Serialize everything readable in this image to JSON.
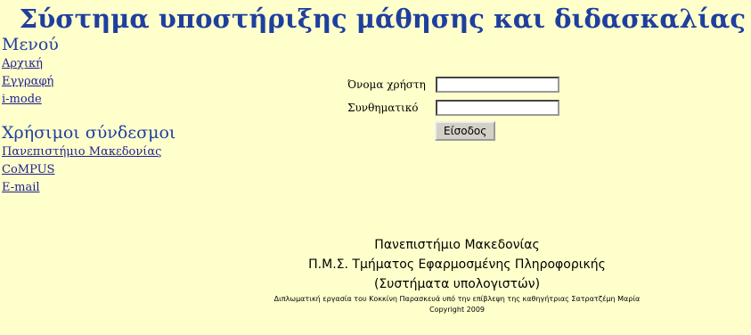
{
  "header": {
    "title": "Σύστημα υποστήριξης μάθησης και διδασκαλίας"
  },
  "sidebar": {
    "menu_heading": "Μενού",
    "menu_items": [
      {
        "label": "Αρχική"
      },
      {
        "label": "Εγγραφή"
      },
      {
        "label": "i-mode"
      }
    ],
    "links_heading": "Χρήσιμοι σύνδεσμοι",
    "link_items": [
      {
        "label": "Πανεπιστήμιο Μακεδονίας"
      },
      {
        "label": "CoMPUS"
      },
      {
        "label": "E-mail"
      }
    ]
  },
  "login": {
    "username_label": "Όνομα χρήστη",
    "username_value": "",
    "password_label": "Συνθηματικό",
    "password_value": "",
    "submit_label": "Είσοδος"
  },
  "footer": {
    "line1": "Πανεπιστήμιο Μακεδονίας",
    "line2": "Π.Μ.Σ. Τμήματος Εφαρμοσμένης Πληροφορικής",
    "line3": "(Συστήματα υπολογιστών)",
    "credit": "Διπλωματική εργασία του Κοκκίνη Παρασκευά υπό την επίβλεψη της καθηγήτριας Σατρατζέμη Μαρία",
    "copyright": "Copyright 2009"
  }
}
